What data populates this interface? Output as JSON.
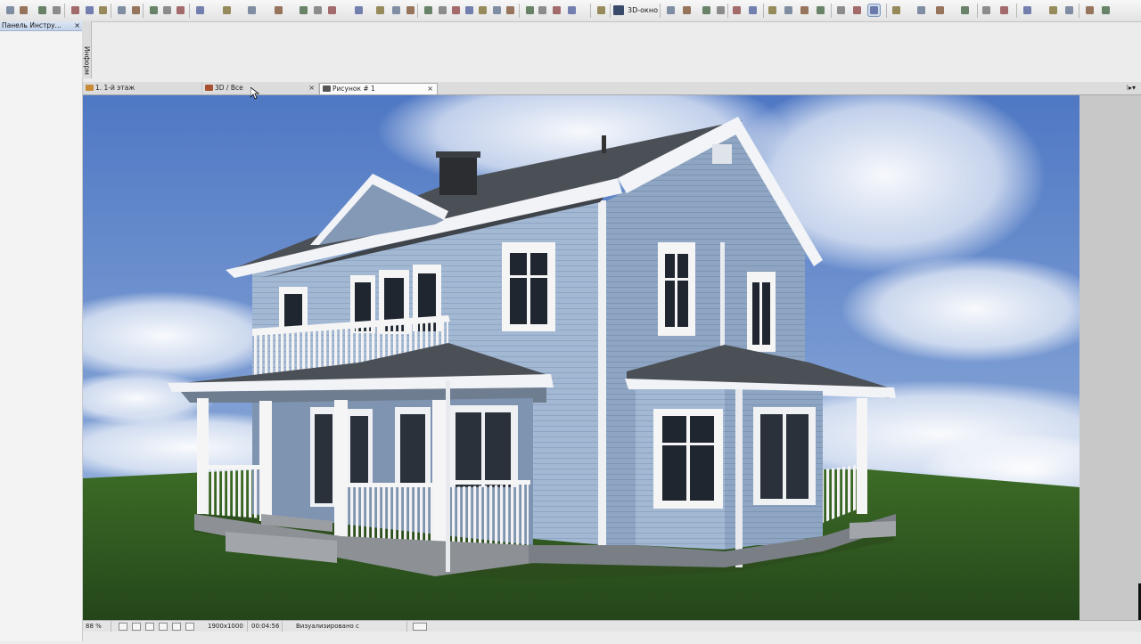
{
  "toolbar": {
    "view3d_label": "3D-окно"
  },
  "left_panel": {
    "title": "Панель Инстру...",
    "close": "×"
  },
  "info_strip": {
    "label": "Информ"
  },
  "tabs": [
    {
      "label": "1. 1-й этаж",
      "icon": "floor-plan-icon",
      "close": ""
    },
    {
      "label": "3D / Все",
      "icon": "3d-view-icon",
      "close": "×"
    },
    {
      "label": "Рисунок # 1",
      "icon": "camera-icon",
      "close": "×"
    }
  ],
  "tab_menu": "⁝▸▾",
  "status": {
    "zoom": "88 %",
    "resolution": "1900x1000",
    "time": "00:04:56",
    "message": "Визуализировано с использованием"
  },
  "colors": {
    "sky_top": "#4f78c4",
    "sky_bottom": "#8fb0dd",
    "grass": "#2f5a1f",
    "siding": "#9cb3cf",
    "trim": "#f2f2f2",
    "roof": "#4a4e55",
    "accent": "#7e96bb"
  }
}
